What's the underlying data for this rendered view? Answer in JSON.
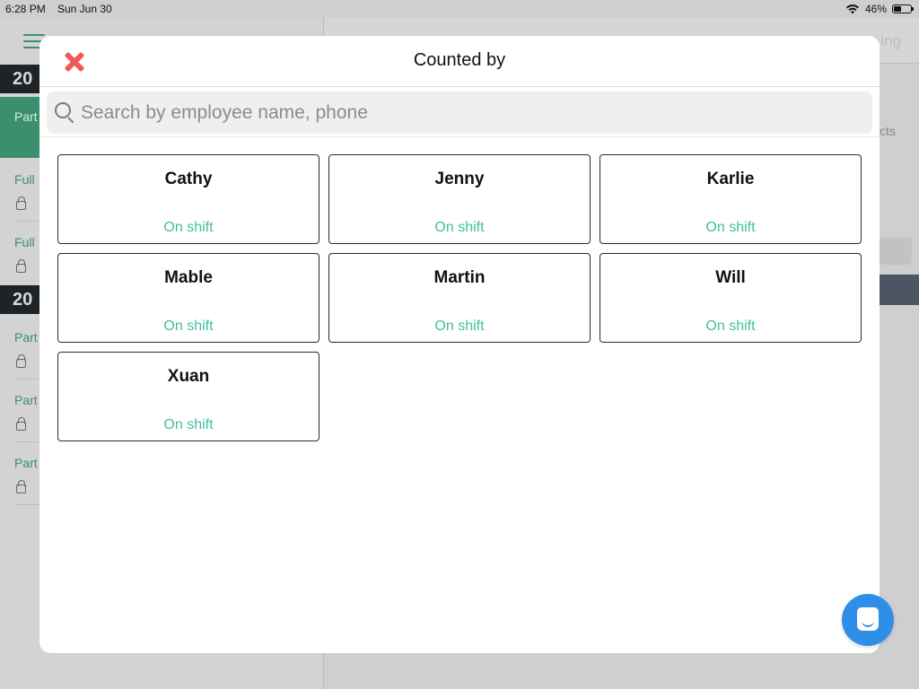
{
  "status_bar": {
    "time": "6:28 PM",
    "date": "Sun Jun 30",
    "battery": "46%",
    "battery_level": 0.46,
    "wifi_icon": "wifi-icon",
    "battery_icon": "battery-icon"
  },
  "background": {
    "right_header_text": "ing",
    "right_text": "cts",
    "year_1": "20",
    "year_2": "20",
    "sidebar_labels": [
      "Part",
      "Full",
      "Full",
      "Part",
      "Part",
      "Part"
    ]
  },
  "modal": {
    "title": "Counted by",
    "close_icon": "close-icon",
    "search": {
      "placeholder": "Search by employee name, phone",
      "value": ""
    },
    "employees": [
      {
        "name": "Cathy",
        "status": "On shift"
      },
      {
        "name": "Jenny",
        "status": "On shift"
      },
      {
        "name": "Karlie",
        "status": "On shift"
      },
      {
        "name": "Mable",
        "status": "On shift"
      },
      {
        "name": "Martin",
        "status": "On shift"
      },
      {
        "name": "Will",
        "status": "On shift"
      },
      {
        "name": "Xuan",
        "status": "On shift"
      }
    ]
  },
  "chat_button_icon": "chat-icon",
  "colors": {
    "close": "#ef5a5a",
    "status_text": "#3fbfa0",
    "chat_button": "#2f8fe8",
    "accent_green": "#3a8f6c"
  }
}
